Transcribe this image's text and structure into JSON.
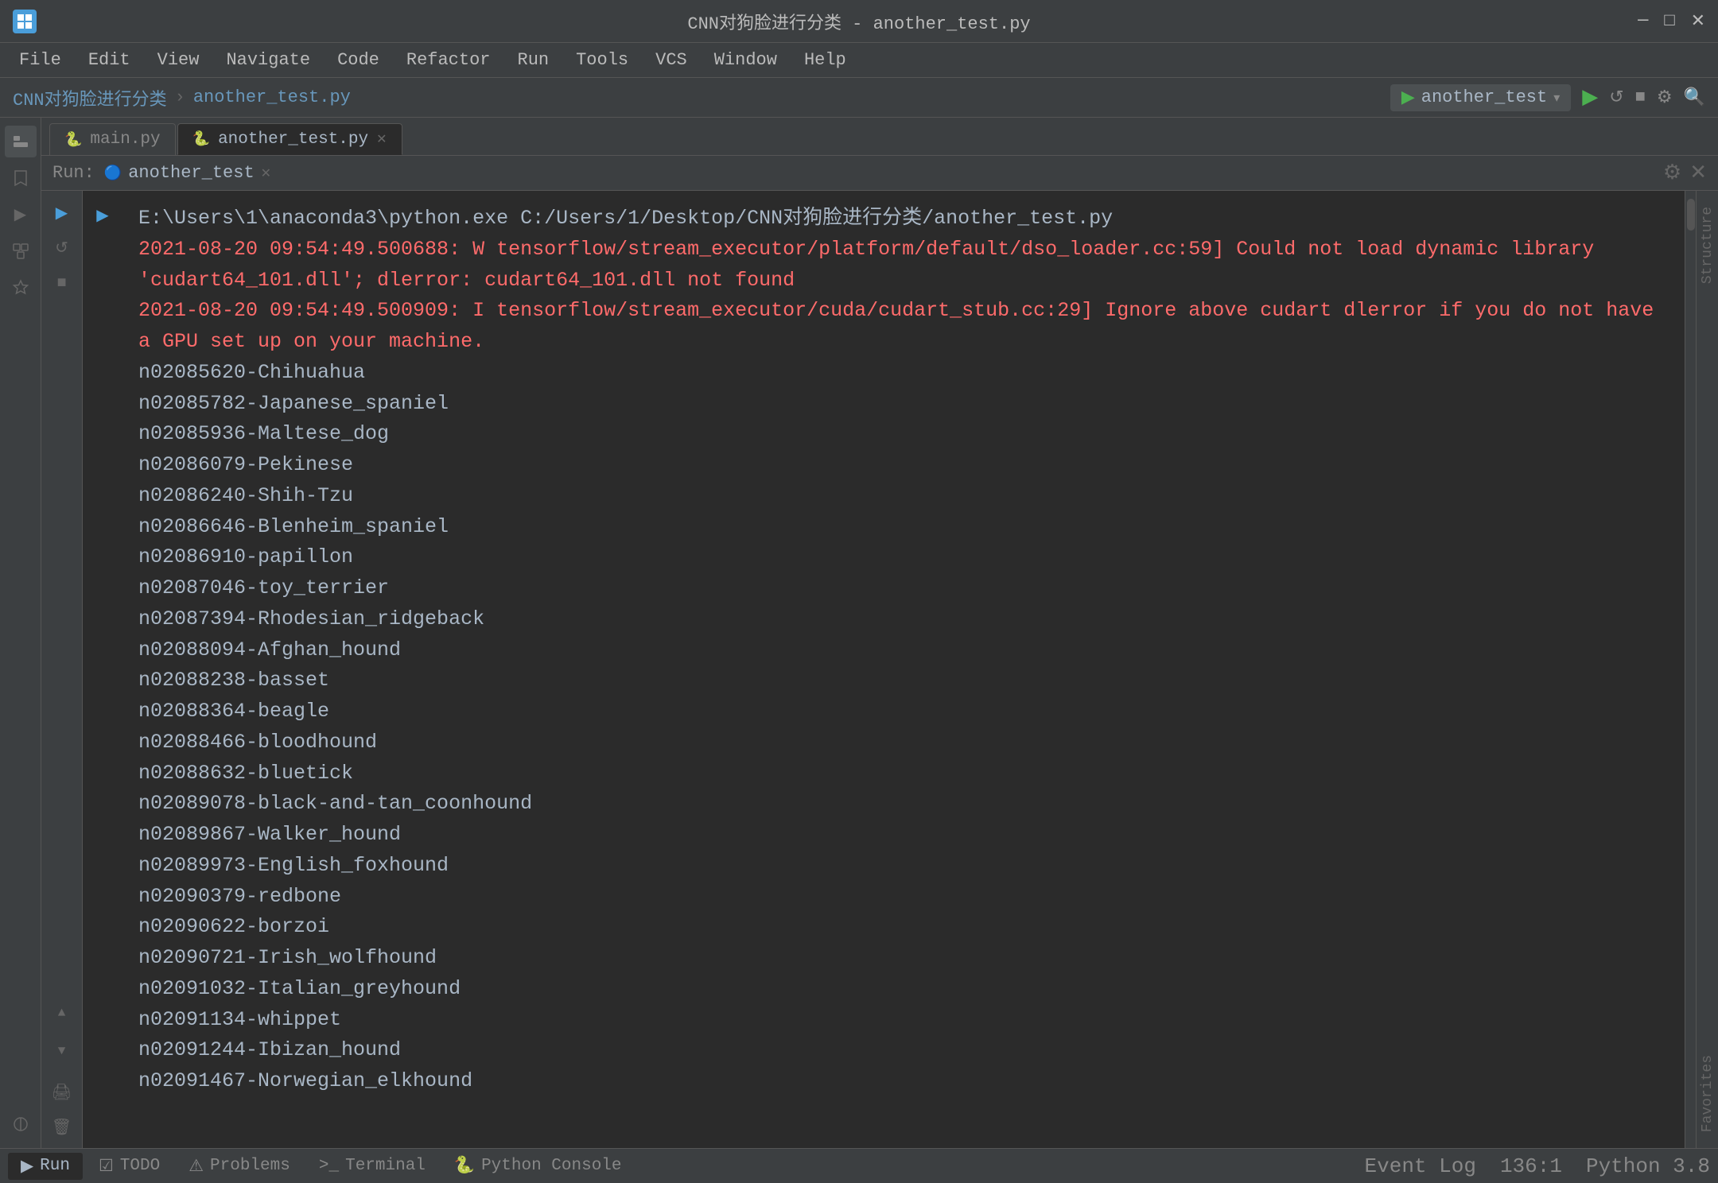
{
  "titlebar": {
    "title": "CNN对狗脸进行分类 - another_test.py",
    "minimize": "─",
    "maximize": "□",
    "close": "✕"
  },
  "menubar": {
    "items": [
      "File",
      "Edit",
      "View",
      "Navigate",
      "Code",
      "Refactor",
      "Run",
      "Tools",
      "VCS",
      "Window",
      "Help"
    ]
  },
  "breadcrumb": {
    "project": "CNN对狗脸进行分类",
    "file": "another_test.py"
  },
  "toolbar": {
    "run_config": "another_test",
    "buttons": [
      "run",
      "rerun",
      "stop",
      "settings",
      "search"
    ]
  },
  "tabs": [
    {
      "label": "main.py",
      "icon": "py",
      "active": false
    },
    {
      "label": "another_test.py",
      "icon": "py",
      "active": true
    }
  ],
  "run": {
    "tab_label": "another_test",
    "tab_icon": "🔵"
  },
  "console": {
    "path_line": "E:\\Users\\1\\anaconda3\\python.exe C:/Users/1/Desktop/CNN对狗脸进行分类/another_test.py",
    "error_lines": [
      "2021-08-20 09:54:49.500688: W tensorflow/stream_executor/platform/default/dso_loader.cc:59] Could not load dynamic library 'cudart64_101.dll'; dlerror: cudart64_101.dll not found",
      "2021-08-20 09:54:49.500909: I tensorflow/stream_executor/cuda/cudart_stub.cc:29] Ignore above cudart dlerror if you do not have a GPU set up on your machine."
    ],
    "dog_breeds": [
      "n02085620-Chihuahua",
      "n02085782-Japanese_spaniel",
      "n02085936-Maltese_dog",
      "n02086079-Pekinese",
      "n02086240-Shih-Tzu",
      "n02086646-Blenheim_spaniel",
      "n02086910-papillon",
      "n02087046-toy_terrier",
      "n02087394-Rhodesian_ridgeback",
      "n02088094-Afghan_hound",
      "n02088238-basset",
      "n02088364-beagle",
      "n02088466-bloodhound",
      "n02088632-bluetick",
      "n02089078-black-and-tan_coonhound",
      "n02089867-Walker_hound",
      "n02089973-English_foxhound",
      "n02090379-redbone",
      "n02090622-borzoi",
      "n02090721-Irish_wolfhound",
      "n02091032-Italian_greyhound",
      "n02091134-whippet",
      "n02091244-Ibizan_hound",
      "n02091467-Norwegian_elkhound"
    ]
  },
  "bottom_tabs": [
    {
      "label": "Run",
      "icon": "▶"
    },
    {
      "label": "TODO",
      "icon": "☑"
    },
    {
      "label": "Problems",
      "icon": "⚠"
    },
    {
      "label": "Terminal",
      "icon": ">"
    },
    {
      "label": "Python Console",
      "icon": "🐍"
    }
  ],
  "status_bar": {
    "event_log": "Event Log",
    "position": "136:1",
    "python_version": "Python 3.8"
  },
  "sidebar_icons": [
    "folder",
    "bookmark",
    "run2",
    "structure",
    "favorites"
  ],
  "right_sidebar": [
    "Structure",
    "Favorites"
  ]
}
